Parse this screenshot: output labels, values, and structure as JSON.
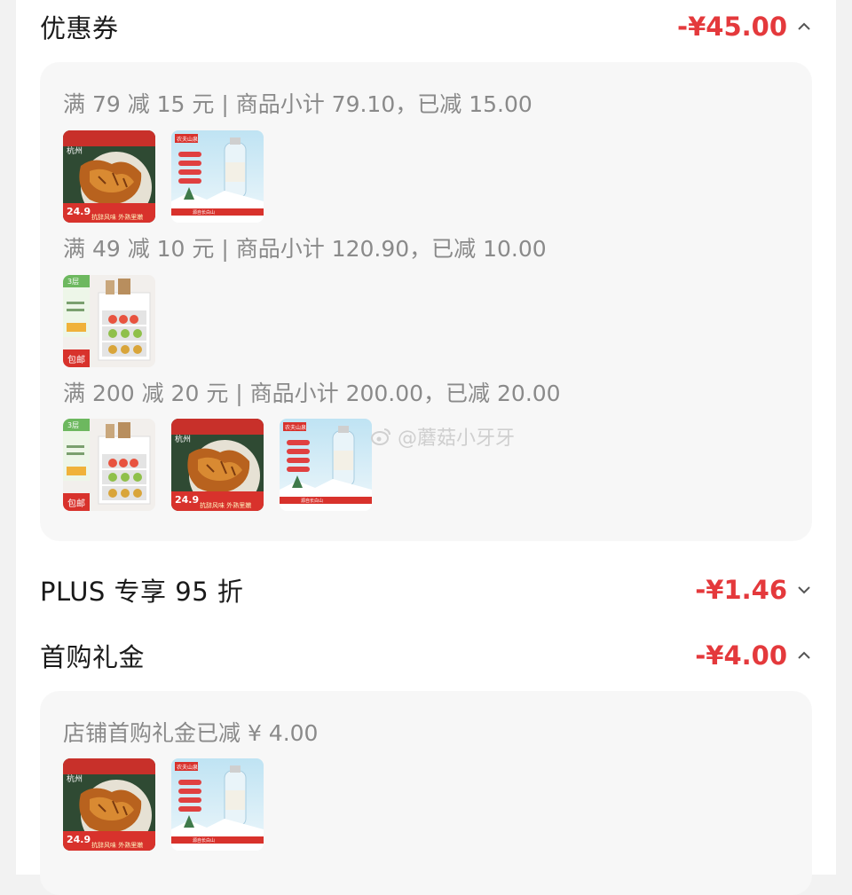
{
  "coupon": {
    "title": "优惠券",
    "amount": "-¥45.00",
    "groups": [
      {
        "text": "满 79 减 15 元 | 商品小计 79.10，已减 15.00",
        "items": [
          "snack-fish",
          "mineral-water"
        ]
      },
      {
        "text": "满 49 减 10 元 | 商品小计 120.90，已减 10.00",
        "items": [
          "storage-cart"
        ]
      },
      {
        "text": "满 200 减 20 元 | 商品小计 200.00，已减 20.00",
        "items": [
          "storage-cart",
          "snack-fish",
          "mineral-water"
        ]
      }
    ]
  },
  "plus": {
    "title": "PLUS 专享 95 折",
    "amount": "-¥1.46"
  },
  "first_gift": {
    "title": "首购礼金",
    "amount": "-¥4.00",
    "detail": "店铺首购礼金已减 ¥ 4.00",
    "items": [
      "snack-fish",
      "mineral-water"
    ]
  },
  "watermark": "@蘑菇小牙牙",
  "thumb_text": {
    "snack_brand": "杭州",
    "snack_price": "24.9",
    "snack_banner": "抗辞风味 外熟里嫩",
    "water_brand": "农夫山泉",
    "water_banner": "源自长白山",
    "cart_badge": "3层",
    "cart_tag": "包邮"
  },
  "colors": {
    "accent": "#e4393c",
    "muted_text": "#8a8a8a",
    "panel": "#f7f7f7"
  }
}
